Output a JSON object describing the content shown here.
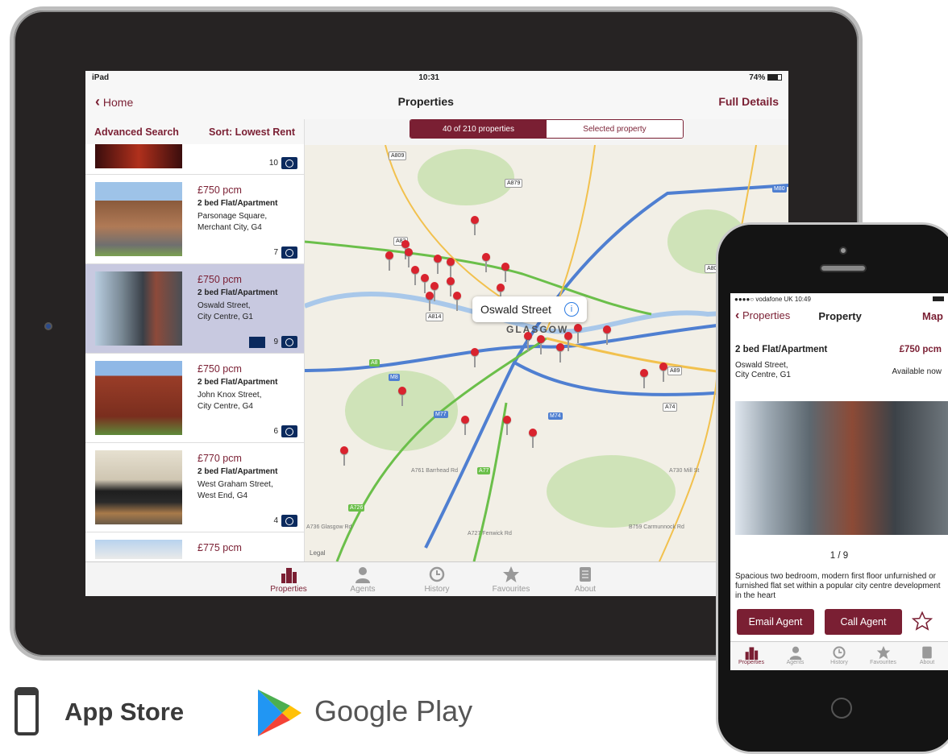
{
  "ipad": {
    "status": {
      "carrier": "iPad",
      "time": "10:31",
      "battery": "74%"
    },
    "nav": {
      "back": "Home",
      "title": "Properties",
      "action": "Full Details"
    },
    "list_header": {
      "search": "Advanced Search",
      "sort": "Sort: Lowest Rent"
    },
    "segments": {
      "left": "40 of 210 properties",
      "right": "Selected property"
    },
    "top_photo_count": "10",
    "listings": [
      {
        "price": "£750 pcm",
        "type": "2 bed Flat/Apartment",
        "addr1": "Parsonage Square,",
        "addr2": "Merchant City, G4",
        "photos": "7"
      },
      {
        "price": "£750 pcm",
        "type": "2 bed Flat/Apartment",
        "addr1": "Oswald Street,",
        "addr2": "City Centre, G1",
        "photos": "9"
      },
      {
        "price": "£750 pcm",
        "type": "2 bed Flat/Apartment",
        "addr1": "John Knox Street,",
        "addr2": "City Centre, G4",
        "photos": "6"
      },
      {
        "price": "£770 pcm",
        "type": "2 bed Flat/Apartment",
        "addr1": "West Graham Street,",
        "addr2": "West End, G4",
        "photos": "4"
      },
      {
        "price": "£775 pcm"
      }
    ],
    "map": {
      "callout": "Oswald Street",
      "city_label": "GLASGOW",
      "legal": "Legal",
      "road_labels": [
        "A809",
        "A879",
        "A82",
        "A814",
        "M80",
        "A80",
        "M8",
        "A89",
        "A74",
        "M77",
        "M74",
        "A8",
        "A77",
        "A726",
        "A736 Glasgow Rd",
        "A727 Fenwick Rd",
        "A761 Barrhead Rd",
        "A730 Mill St",
        "B759 Carmunnock Rd"
      ]
    },
    "tabs": [
      "Properties",
      "Agents",
      "History",
      "Favourites",
      "About"
    ]
  },
  "iphone": {
    "status": {
      "carrier": "●●●●○ vodafone UK",
      "time": "10:49"
    },
    "nav": {
      "back": "Properties",
      "title": "Property",
      "action": "Map"
    },
    "type": "2 bed Flat/Apartment",
    "price": "£750 pcm",
    "addr1": "Oswald Street,",
    "addr2": "City Centre, G1",
    "availability": "Available now",
    "photo_counter": "1 / 9",
    "description": "Spacious two bedroom, modern first floor unfurnished or furnished flat set within a popular city centre development in the heart",
    "email_btn": "Email Agent",
    "call_btn": "Call Agent",
    "tabs": [
      "Properties",
      "Agents",
      "History",
      "Favourites",
      "About"
    ]
  },
  "stores": {
    "apple": "App Store",
    "google": "Google Play"
  },
  "colors": {
    "accent": "#7a1f33",
    "selected_row": "#c8c9e0",
    "pin": "#d9232e",
    "motorway": "#4f7fd1",
    "a_road": "#6bbf4a"
  }
}
